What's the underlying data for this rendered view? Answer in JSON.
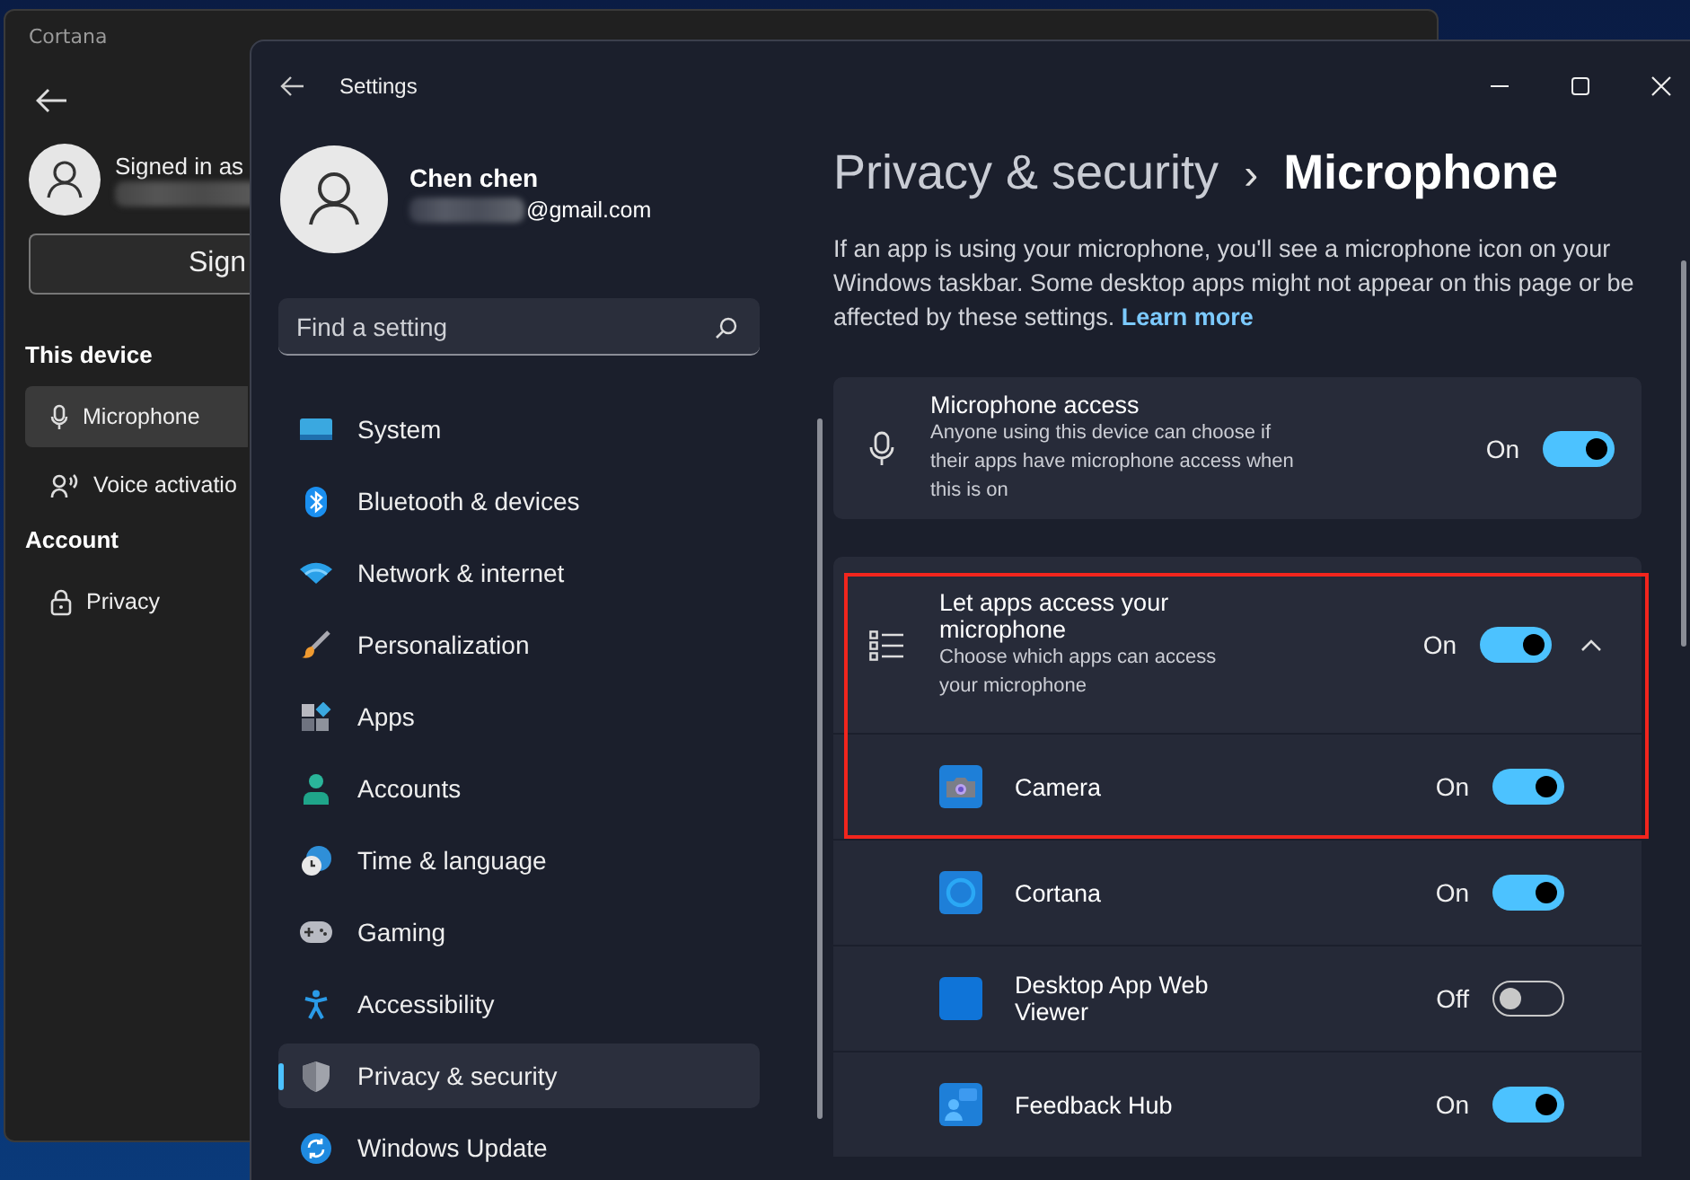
{
  "background_window": {
    "title": "Cortana",
    "account_label": "Signed in as",
    "sign_button": "Sign",
    "sections": [
      {
        "heading": "This device",
        "items": [
          {
            "label": "Microphone",
            "selected": true
          },
          {
            "label": "Voice activatio",
            "selected": false
          }
        ]
      },
      {
        "heading": "Account",
        "items": [
          {
            "label": "Privacy",
            "selected": false
          }
        ]
      }
    ]
  },
  "window": {
    "title": "Settings",
    "user": {
      "name": "Chen chen",
      "email": "@gmail.com"
    },
    "search": {
      "placeholder": "Find a setting"
    },
    "nav": [
      {
        "label": "System",
        "selected": false
      },
      {
        "label": "Bluetooth & devices",
        "selected": false
      },
      {
        "label": "Network & internet",
        "selected": false
      },
      {
        "label": "Personalization",
        "selected": false
      },
      {
        "label": "Apps",
        "selected": false
      },
      {
        "label": "Accounts",
        "selected": false
      },
      {
        "label": "Time & language",
        "selected": false
      },
      {
        "label": "Gaming",
        "selected": false
      },
      {
        "label": "Accessibility",
        "selected": false
      },
      {
        "label": "Privacy & security",
        "selected": true
      },
      {
        "label": "Windows Update",
        "selected": false
      }
    ],
    "breadcrumb": {
      "parent": "Privacy & security",
      "separator": "›",
      "current": "Microphone"
    },
    "description": "If an app is using your microphone, you'll see a microphone icon on your Windows taskbar. Some desktop apps might not appear on this page or be affected by these settings.",
    "learn_more": "Learn more",
    "settings": [
      {
        "kind": "toggle",
        "title": "Microphone access",
        "description": "Anyone using this device can choose if their apps have microphone access when this is on",
        "state_label": "On",
        "on": true
      },
      {
        "kind": "expander",
        "title": "Let apps access your microphone",
        "description": "Choose which apps can access your microphone",
        "state_label": "On",
        "on": true,
        "expanded": true,
        "highlighted": true,
        "apps": [
          {
            "name": "Camera",
            "state_label": "On",
            "on": true,
            "highlighted": true
          },
          {
            "name": "Cortana",
            "state_label": "On",
            "on": true,
            "highlighted": false
          },
          {
            "name": "Desktop App Web Viewer",
            "state_label": "Off",
            "on": false,
            "highlighted": false
          },
          {
            "name": "Feedback Hub",
            "state_label": "On",
            "on": true,
            "highlighted": false
          }
        ]
      }
    ]
  }
}
